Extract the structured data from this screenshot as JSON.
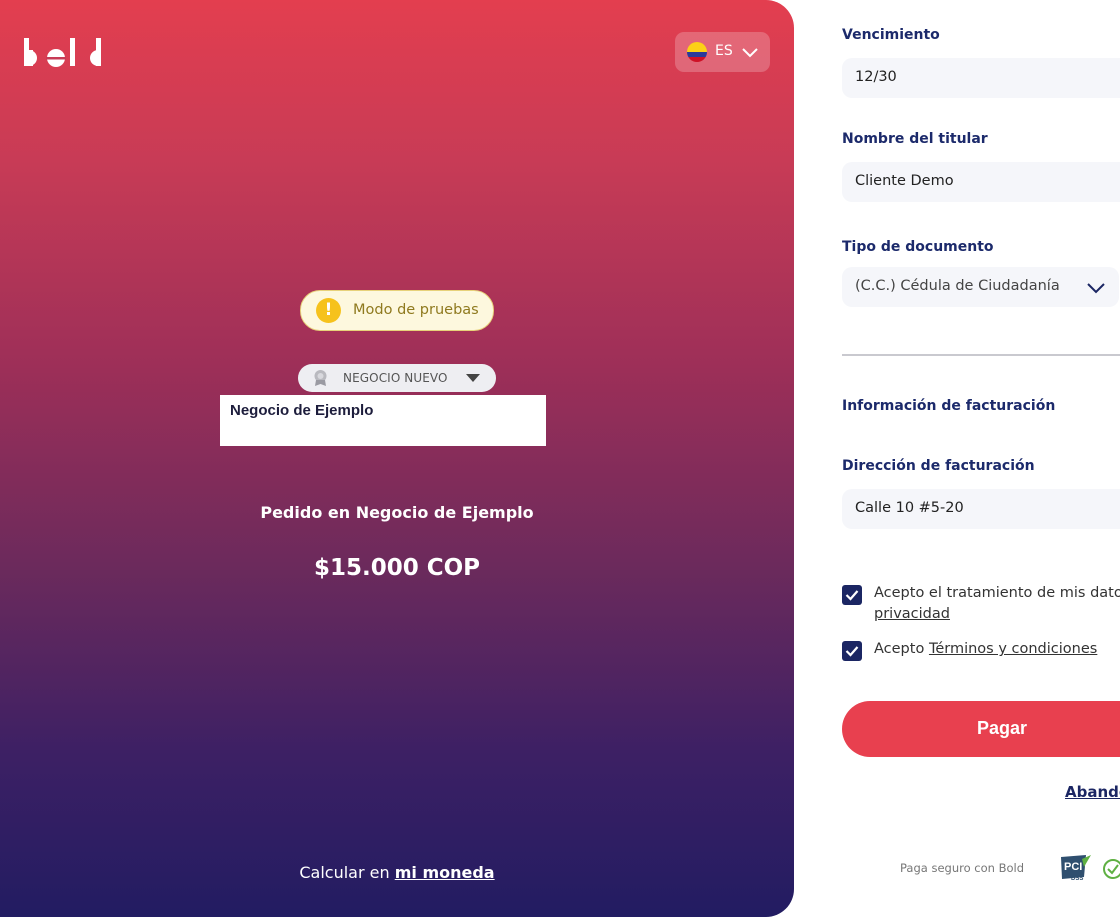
{
  "brand": {
    "logo_text": "bold"
  },
  "language": {
    "code": "ES",
    "flag_icon": "colombia-flag-icon"
  },
  "test_mode": {
    "label": "Modo de pruebas",
    "icon": "exclamation-icon"
  },
  "business": {
    "badge_label": "NEGOCIO NUEVO",
    "name": "Negocio de Ejemplo"
  },
  "order": {
    "title": "Pedido en Negocio de Ejemplo",
    "amount": "$15.000 COP"
  },
  "currency": {
    "prefix": "Calcular en ",
    "link": "mi moneda"
  },
  "form": {
    "expiry": {
      "label": "Vencimiento",
      "value": "12/30"
    },
    "holder": {
      "label": "Nombre del titular",
      "value": "Cliente Demo"
    },
    "doc_type": {
      "label": "Tipo de documento",
      "value": "(C.C.) Cédula de Ciudadanía"
    },
    "billing_section": "Información de facturación",
    "billing_address": {
      "label": "Dirección de facturación",
      "value": "Calle 10 #5-20"
    },
    "consent_data": {
      "text": "Acepto el tratamiento de mis datos",
      "link": "privacidad",
      "checked": true
    },
    "consent_terms": {
      "prefix": "Acepto ",
      "link": "Términos y condiciones",
      "checked": true
    },
    "pay_label": "Pagar",
    "abandon_label": "Abando",
    "secure_text": "Paga seguro con Bold"
  },
  "colors": {
    "accent": "#e8404f",
    "navy": "#1b2663",
    "label": "#1c2a6b"
  }
}
